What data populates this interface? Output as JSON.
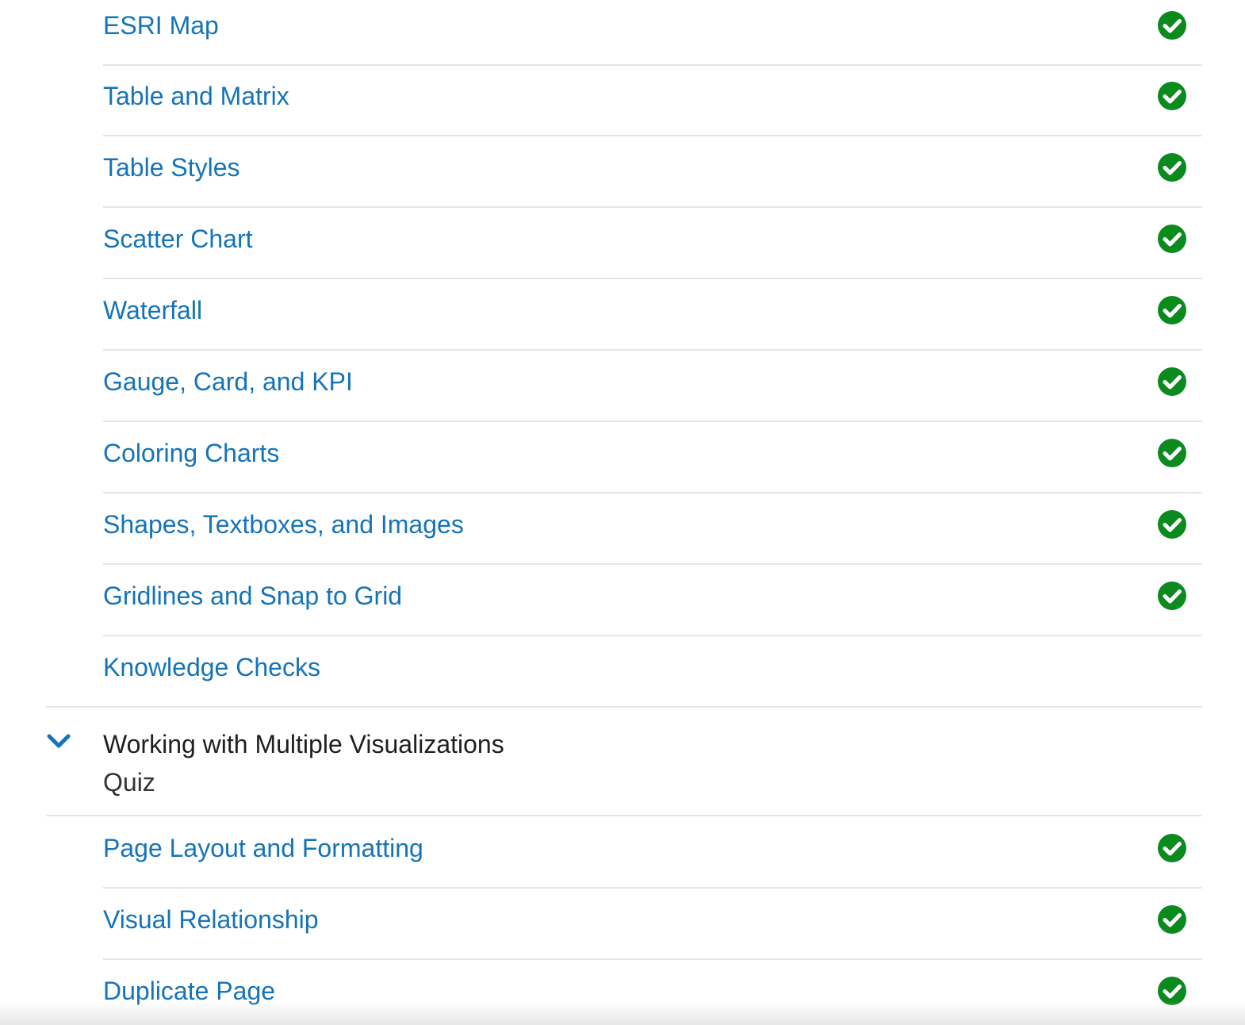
{
  "colors": {
    "link": "#1574b8",
    "check_fill": "#0b8a1e",
    "divider": "#e6e6e6",
    "chevron": "#1574b8"
  },
  "items_top": [
    {
      "label": "ESRI Map",
      "completed": true,
      "icon": "check-circle-icon"
    },
    {
      "label": "Table and Matrix",
      "completed": true,
      "icon": "check-circle-icon"
    },
    {
      "label": "Table Styles",
      "completed": true,
      "icon": "check-circle-icon"
    },
    {
      "label": "Scatter Chart",
      "completed": true,
      "icon": "check-circle-icon"
    },
    {
      "label": "Waterfall",
      "completed": true,
      "icon": "check-circle-icon"
    },
    {
      "label": "Gauge, Card, and KPI",
      "completed": true,
      "icon": "check-circle-icon"
    },
    {
      "label": "Coloring Charts",
      "completed": true,
      "icon": "check-circle-icon"
    },
    {
      "label": "Shapes, Textboxes, and Images",
      "completed": true,
      "icon": "check-circle-icon"
    },
    {
      "label": "Gridlines and Snap to Grid",
      "completed": true,
      "icon": "check-circle-icon"
    },
    {
      "label": "Knowledge Checks",
      "completed": false,
      "icon": ""
    }
  ],
  "section": {
    "title": "Working with Multiple Visualizations",
    "subtitle": "Quiz",
    "expanded": true,
    "icon": "chevron-down-icon"
  },
  "items_bottom": [
    {
      "label": "Page Layout and Formatting",
      "completed": true,
      "icon": "check-circle-icon"
    },
    {
      "label": "Visual Relationship",
      "completed": true,
      "icon": "check-circle-icon"
    },
    {
      "label": "Duplicate Page",
      "completed": true,
      "icon": "check-circle-icon"
    }
  ]
}
